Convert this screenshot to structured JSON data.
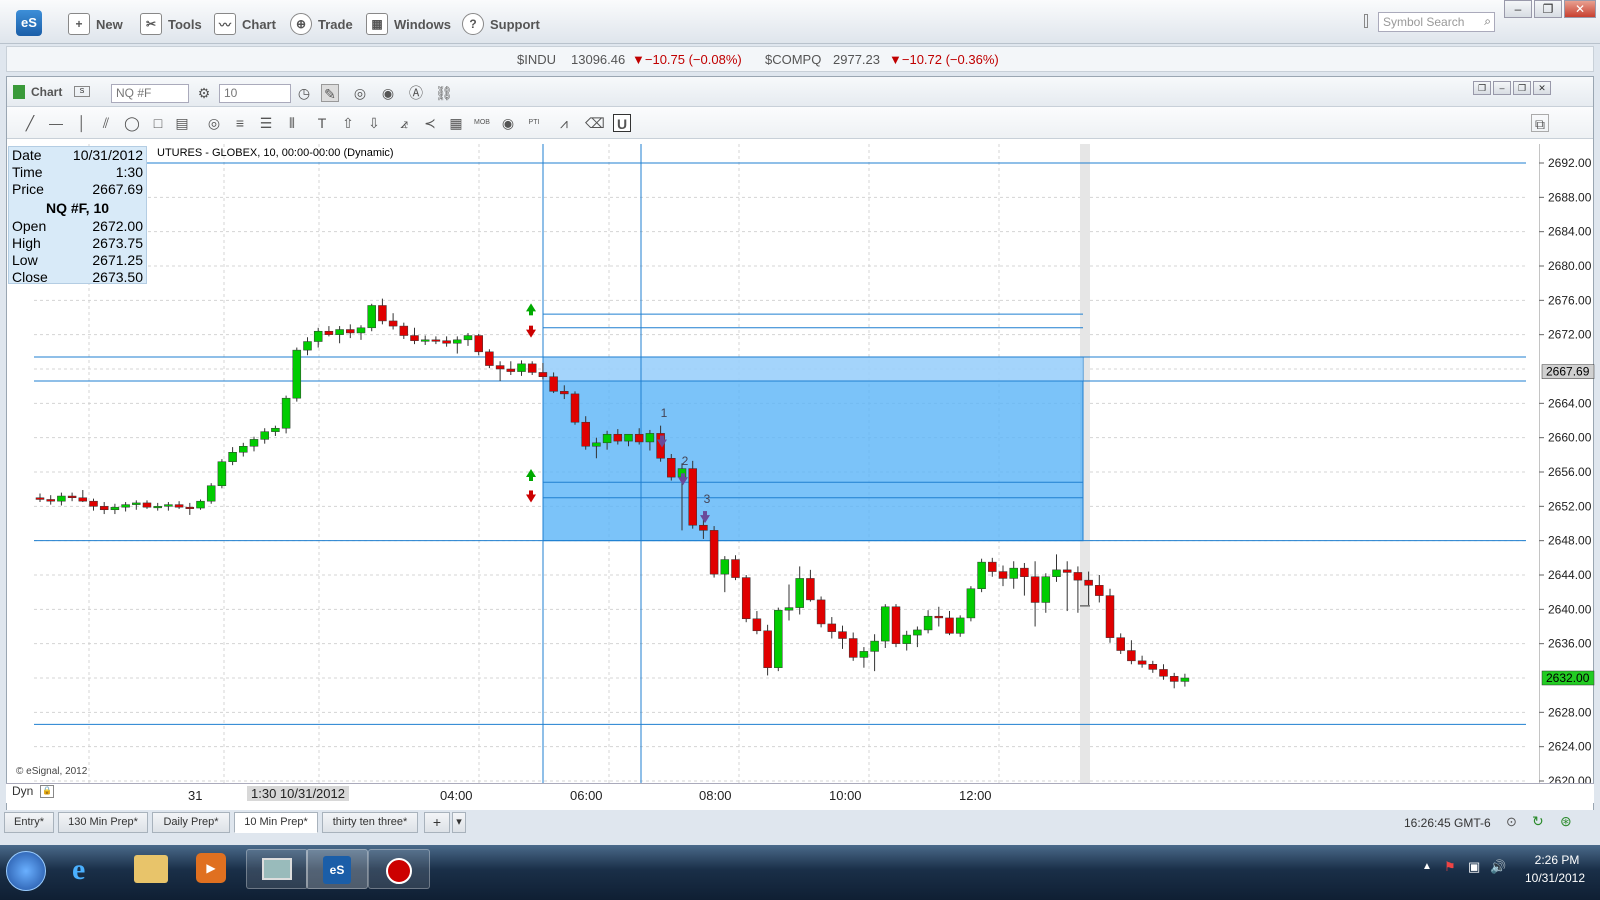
{
  "app": {
    "logo": "eS"
  },
  "menu": [
    {
      "label": "New",
      "icon": "new-icon"
    },
    {
      "label": "Tools",
      "icon": "tools-icon"
    },
    {
      "label": "Chart",
      "icon": "chart-icon"
    },
    {
      "label": "Trade",
      "icon": "trade-icon"
    },
    {
      "label": "Windows",
      "icon": "windows-icon"
    },
    {
      "label": "Support",
      "icon": "support-icon"
    }
  ],
  "search": {
    "placeholder": "Symbol Search"
  },
  "ticker": [
    {
      "symbol": "$INDU",
      "price": "13096.46",
      "change": "▼−10.75 (−0.08%)"
    },
    {
      "symbol": "$COMPQ",
      "price": "2977.23",
      "change": "▼−10.72 (−0.36%)"
    }
  ],
  "chart_header": {
    "label": "Chart",
    "symbol": "NQ #F",
    "interval": "10"
  },
  "infobox": {
    "date_label": "Date",
    "date": "10/31/2012",
    "time_label": "Time",
    "time": "1:30",
    "price_label": "Price",
    "price": "2667.69",
    "symbol": "NQ #F, 10",
    "open_label": "Open",
    "open": "2672.00",
    "high_label": "High",
    "high": "2673.75",
    "low_label": "Low",
    "low": "2671.25",
    "close_label": "Close",
    "close": "2673.50"
  },
  "chart_title": "UTURES - GLOBEX, 10, 00:00-00:00 (Dynamic)",
  "copyright": "© eSignal, 2012",
  "price_axis": [
    "2692.00",
    "2688.00",
    "2684.00",
    "2680.00",
    "2676.00",
    "2672.00",
    "2664.00",
    "2660.00",
    "2656.00",
    "2652.00",
    "2648.00",
    "2644.00",
    "2640.00",
    "2636.00",
    "2628.00",
    "2624.00",
    "2620.00"
  ],
  "price_marker_cursor": "2667.69",
  "price_marker_last": "2632.00",
  "annotations": [
    "1",
    "2",
    "3"
  ],
  "x_axis": {
    "day": "31",
    "cursor": "1:30 10/31/2012",
    "times": [
      "04:00",
      "06:00",
      "08:00",
      "10:00",
      "12:00"
    ]
  },
  "dyn_label": "Dyn",
  "tabs": [
    "Entry*",
    "130 Min Prep*",
    "Daily Prep*",
    "10 Min Prep*",
    "thirty ten three*"
  ],
  "status_clock": "16:26:45 GMT-6",
  "taskbar_clock": {
    "time": "2:26 PM",
    "date": "10/31/2012"
  },
  "colors": {
    "up": "#00cc00",
    "down": "#e00000",
    "zone": "#5ab4f8",
    "line": "#1f7fd0"
  },
  "chart_data": {
    "type": "candlestick",
    "candles": [
      [
        2653.0,
        2653.5,
        2652.5,
        2652.8
      ],
      [
        2652.8,
        2653.3,
        2652.2,
        2652.6
      ],
      [
        2652.6,
        2653.6,
        2652.1,
        2653.2
      ],
      [
        2653.2,
        2653.6,
        2652.6,
        2653.0
      ],
      [
        2653.0,
        2653.9,
        2652.5,
        2652.6
      ],
      [
        2652.6,
        2652.9,
        2651.5,
        2652.0
      ],
      [
        2652.0,
        2652.5,
        2651.1,
        2651.6
      ],
      [
        2651.6,
        2652.3,
        2651.1,
        2651.9
      ],
      [
        2651.9,
        2652.5,
        2651.4,
        2652.2
      ],
      [
        2652.2,
        2652.7,
        2651.6,
        2652.4
      ],
      [
        2652.4,
        2652.7,
        2651.7,
        2651.9
      ],
      [
        2651.9,
        2652.4,
        2651.5,
        2652.0
      ],
      [
        2652.0,
        2652.5,
        2651.5,
        2652.2
      ],
      [
        2652.2,
        2652.6,
        2651.7,
        2651.9
      ],
      [
        2651.9,
        2652.4,
        2651.0,
        2651.8
      ],
      [
        2651.8,
        2652.8,
        2651.6,
        2652.6
      ],
      [
        2652.6,
        2654.7,
        2652.3,
        2654.4
      ],
      [
        2654.4,
        2657.5,
        2654.1,
        2657.2
      ],
      [
        2657.2,
        2658.9,
        2656.8,
        2658.3
      ],
      [
        2658.3,
        2659.4,
        2657.8,
        2659.0
      ],
      [
        2659.0,
        2660.1,
        2658.4,
        2659.8
      ],
      [
        2659.8,
        2661.1,
        2659.3,
        2660.7
      ],
      [
        2660.7,
        2661.4,
        2660.2,
        2661.1
      ],
      [
        2661.1,
        2664.9,
        2660.5,
        2664.6
      ],
      [
        2664.6,
        2670.5,
        2664.2,
        2670.2
      ],
      [
        2670.2,
        2671.7,
        2669.6,
        2671.2
      ],
      [
        2671.2,
        2672.8,
        2670.5,
        2672.4
      ],
      [
        2672.4,
        2673.0,
        2671.8,
        2672.0
      ],
      [
        2672.0,
        2673.0,
        2671.0,
        2672.6
      ],
      [
        2672.6,
        2673.2,
        2671.6,
        2672.2
      ],
      [
        2672.2,
        2673.1,
        2671.4,
        2672.8
      ],
      [
        2672.8,
        2675.6,
        2672.4,
        2675.4
      ],
      [
        2675.4,
        2676.2,
        2673.2,
        2673.6
      ],
      [
        2673.6,
        2674.5,
        2672.6,
        2673.0
      ],
      [
        2673.0,
        2673.4,
        2671.5,
        2671.9
      ],
      [
        2671.9,
        2672.8,
        2670.9,
        2671.3
      ],
      [
        2671.3,
        2671.9,
        2670.8,
        2671.4
      ],
      [
        2671.4,
        2671.8,
        2670.9,
        2671.3
      ],
      [
        2671.3,
        2671.8,
        2670.6,
        2671.0
      ],
      [
        2671.0,
        2671.8,
        2669.8,
        2671.4
      ],
      [
        2671.4,
        2672.2,
        2670.7,
        2671.9
      ],
      [
        2671.9,
        2672.1,
        2669.6,
        2670.0
      ],
      [
        2670.0,
        2670.3,
        2668.1,
        2668.4
      ],
      [
        2668.4,
        2668.9,
        2666.6,
        2668.0
      ],
      [
        2668.0,
        2668.9,
        2667.3,
        2667.7
      ],
      [
        2667.7,
        2669.0,
        2667.2,
        2668.6
      ],
      [
        2668.6,
        2668.9,
        2667.3,
        2667.6
      ],
      [
        2667.6,
        2668.7,
        2666.8,
        2667.1
      ],
      [
        2667.1,
        2667.6,
        2665.2,
        2665.4
      ],
      [
        2665.4,
        2666.1,
        2664.5,
        2665.1
      ],
      [
        2665.1,
        2665.4,
        2661.5,
        2661.8
      ],
      [
        2661.8,
        2662.5,
        2658.6,
        2659.0
      ],
      [
        2659.0,
        2660.0,
        2657.6,
        2659.4
      ],
      [
        2659.4,
        2660.8,
        2658.6,
        2660.4
      ],
      [
        2660.4,
        2661.0,
        2659.2,
        2659.6
      ],
      [
        2659.6,
        2660.4,
        2659.0,
        2660.4
      ],
      [
        2660.4,
        2661.1,
        2659.2,
        2659.5
      ],
      [
        2659.5,
        2660.9,
        2658.5,
        2660.5
      ],
      [
        2660.5,
        2661.4,
        2657.2,
        2657.6
      ],
      [
        2657.6,
        2658.1,
        2655.0,
        2655.4
      ],
      [
        2655.4,
        2657.0,
        2649.2,
        2656.4
      ],
      [
        2656.4,
        2657.3,
        2649.4,
        2649.8
      ],
      [
        2649.8,
        2650.5,
        2648.2,
        2649.2
      ],
      [
        2649.2,
        2649.7,
        2643.7,
        2644.1
      ],
      [
        2644.1,
        2646.2,
        2642.0,
        2645.8
      ],
      [
        2645.8,
        2646.3,
        2643.4,
        2643.7
      ],
      [
        2643.7,
        2644.0,
        2638.5,
        2638.9
      ],
      [
        2638.9,
        2639.8,
        2637.1,
        2637.5
      ],
      [
        2637.5,
        2638.2,
        2632.3,
        2633.2
      ],
      [
        2633.2,
        2640.2,
        2632.8,
        2639.9
      ],
      [
        2639.9,
        2642.9,
        2638.7,
        2640.2
      ],
      [
        2640.2,
        2645.0,
        2639.4,
        2643.6
      ],
      [
        2643.6,
        2644.6,
        2640.9,
        2641.1
      ],
      [
        2641.1,
        2641.5,
        2637.9,
        2638.3
      ],
      [
        2638.3,
        2639.1,
        2636.6,
        2637.4
      ],
      [
        2637.4,
        2638.1,
        2635.4,
        2636.6
      ],
      [
        2636.6,
        2637.3,
        2634.0,
        2634.4
      ],
      [
        2634.4,
        2635.6,
        2633.2,
        2635.1
      ],
      [
        2635.1,
        2637.1,
        2632.8,
        2636.3
      ],
      [
        2636.3,
        2640.6,
        2635.5,
        2640.3
      ],
      [
        2640.3,
        2640.6,
        2635.6,
        2636.0
      ],
      [
        2636.0,
        2637.5,
        2635.2,
        2637.0
      ],
      [
        2637.0,
        2638.0,
        2635.6,
        2637.6
      ],
      [
        2637.6,
        2639.9,
        2637.2,
        2639.2
      ],
      [
        2639.2,
        2640.3,
        2638.0,
        2639.0
      ],
      [
        2639.0,
        2639.8,
        2637.0,
        2637.2
      ],
      [
        2637.2,
        2639.3,
        2636.8,
        2639.0
      ],
      [
        2639.0,
        2642.7,
        2638.6,
        2642.4
      ],
      [
        2642.4,
        2645.9,
        2642.0,
        2645.5
      ],
      [
        2645.5,
        2646.0,
        2643.8,
        2644.4
      ],
      [
        2644.4,
        2645.1,
        2642.7,
        2643.6
      ],
      [
        2643.6,
        2645.6,
        2642.4,
        2644.8
      ],
      [
        2644.8,
        2645.4,
        2641.6,
        2643.8
      ],
      [
        2643.8,
        2645.6,
        2638.0,
        2640.8
      ],
      [
        2640.8,
        2644.2,
        2639.6,
        2643.8
      ],
      [
        2643.8,
        2646.4,
        2643.2,
        2644.6
      ],
      [
        2644.6,
        2645.6,
        2639.8,
        2644.3
      ],
      [
        2644.3,
        2645.0,
        2639.6,
        2643.4
      ],
      [
        2643.4,
        2644.4,
        2640.5,
        2642.8
      ],
      [
        2642.8,
        2644.0,
        2640.8,
        2641.6
      ],
      [
        2641.6,
        2642.4,
        2636.1,
        2636.7
      ],
      [
        2636.7,
        2637.2,
        2634.8,
        2635.2
      ],
      [
        2635.2,
        2636.4,
        2633.6,
        2634.0
      ],
      [
        2634.0,
        2634.6,
        2633.2,
        2633.6
      ],
      [
        2633.6,
        2634.0,
        2632.6,
        2633.0
      ],
      [
        2633.0,
        2633.6,
        2631.8,
        2632.2
      ],
      [
        2632.2,
        2632.6,
        2630.8,
        2631.6
      ],
      [
        2631.6,
        2632.5,
        2631.0,
        2632.0
      ]
    ],
    "ylim": [
      2620,
      2694
    ],
    "levels": [
      2692.0,
      2674.4,
      2672.8,
      2669.4,
      2666.6,
      2654.8,
      2653.0,
      2648.0,
      2626.6
    ]
  }
}
